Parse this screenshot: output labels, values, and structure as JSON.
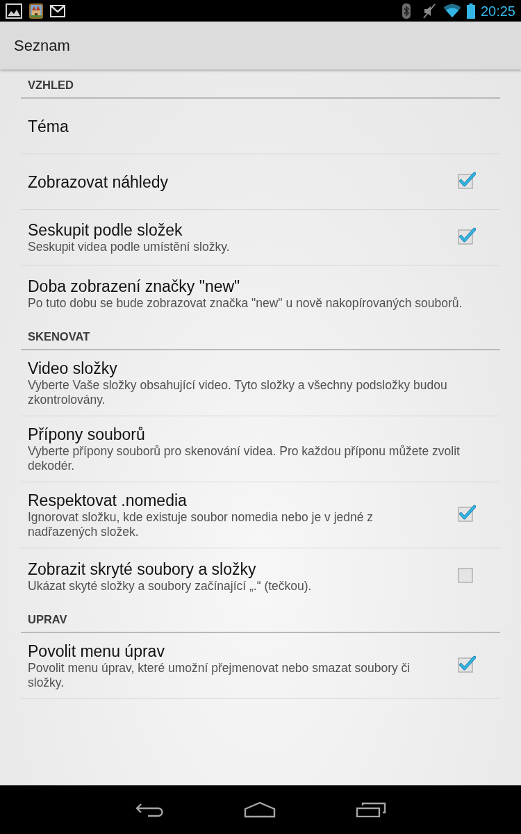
{
  "status_bar": {
    "time": "20:25"
  },
  "action_bar": {
    "title": "Seznam"
  },
  "sections": [
    {
      "title": "VZHLED",
      "items": [
        {
          "kind": "plain",
          "title": "Téma"
        },
        {
          "kind": "checkbox",
          "title": "Zobrazovat náhledy",
          "checked": true
        },
        {
          "kind": "checkbox",
          "title": "Seskupit podle složek",
          "summary": "Seskupit videa podle umístění složky.",
          "checked": true
        },
        {
          "kind": "plain",
          "title": "Doba zobrazení značky \"new\"",
          "summary": "Po tuto dobu se bude zobrazovat značka \"new\" u nově nakopírovaných souborů."
        }
      ]
    },
    {
      "title": "SKENOVAT",
      "items": [
        {
          "kind": "plain",
          "title": "Video složky",
          "summary": "Vyberte Vaše složky obsahující video. Tyto složky a všechny podsložky budou zkontrolovány."
        },
        {
          "kind": "plain",
          "title": "Přípony souborů",
          "summary": "Vyberte přípony souborů pro skenování videa. Pro každou příponu můžete zvolit dekodér."
        },
        {
          "kind": "checkbox",
          "title": "Respektovat .nomedia",
          "summary": "Ignorovat složku, kde existuje soubor nomedia nebo je v jedné z nadřazených složek.",
          "checked": true
        },
        {
          "kind": "checkbox",
          "title": "Zobrazit skryté soubory a složky",
          "summary": "Ukázat skyté složky a soubory začínající „.“ (tečkou).",
          "checked": false
        }
      ]
    },
    {
      "title": "UPRAV",
      "items": [
        {
          "kind": "checkbox",
          "title": "Povolit menu úprav",
          "summary": "Povolit menu úprav, které umožní přejmenovat nebo smazat soubory či složky.",
          "checked": true
        }
      ]
    }
  ]
}
